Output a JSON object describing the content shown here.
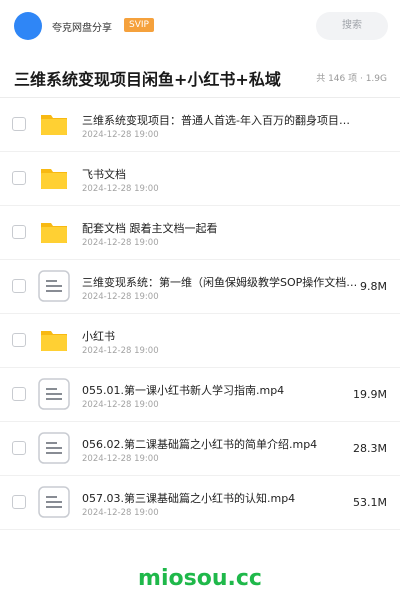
{
  "header": {
    "username": "夸克网盘分享",
    "badge": "SVIP",
    "search_placeholder": "搜索",
    "accent_color": "#2f86f6"
  },
  "folder": {
    "title": "三维系统变现项目闲鱼+小红书+私域",
    "summary": "共 146 项 · 1.9G"
  },
  "files": [
    {
      "name": "三维系统变现项目：普通人首选-年入百万的翻身项目，…",
      "date": "2024-12-28 19:00",
      "size": "",
      "icon": "folder-icon"
    },
    {
      "name": "飞书文档",
      "date": "2024-12-28 19:00",
      "size": "",
      "icon": "folder-icon"
    },
    {
      "name": "配套文档 跟着主文档一起看",
      "date": "2024-12-28 19:00",
      "size": "",
      "icon": "folder-icon"
    },
    {
      "name": "三维变现系统：第一维（闲鱼保姆级教学SOP操作文档…",
      "date": "2024-12-28 19:00",
      "size": "9.8M",
      "icon": "document-icon"
    },
    {
      "name": "小红书",
      "date": "2024-12-28 19:00",
      "size": "",
      "icon": "folder-icon"
    },
    {
      "name": "055.01.第一课小红书新人学习指南.mp4",
      "date": "2024-12-28 19:00",
      "size": "19.9M",
      "icon": "document-icon"
    },
    {
      "name": "056.02.第二课基础篇之小红书的简单介绍.mp4",
      "date": "2024-12-28 19:00",
      "size": "28.3M",
      "icon": "document-icon"
    },
    {
      "name": "057.03.第三课基础篇之小红书的认知.mp4",
      "date": "2024-12-28 19:00",
      "size": "53.1M",
      "icon": "document-icon"
    }
  ],
  "watermark": "miosou.cc"
}
